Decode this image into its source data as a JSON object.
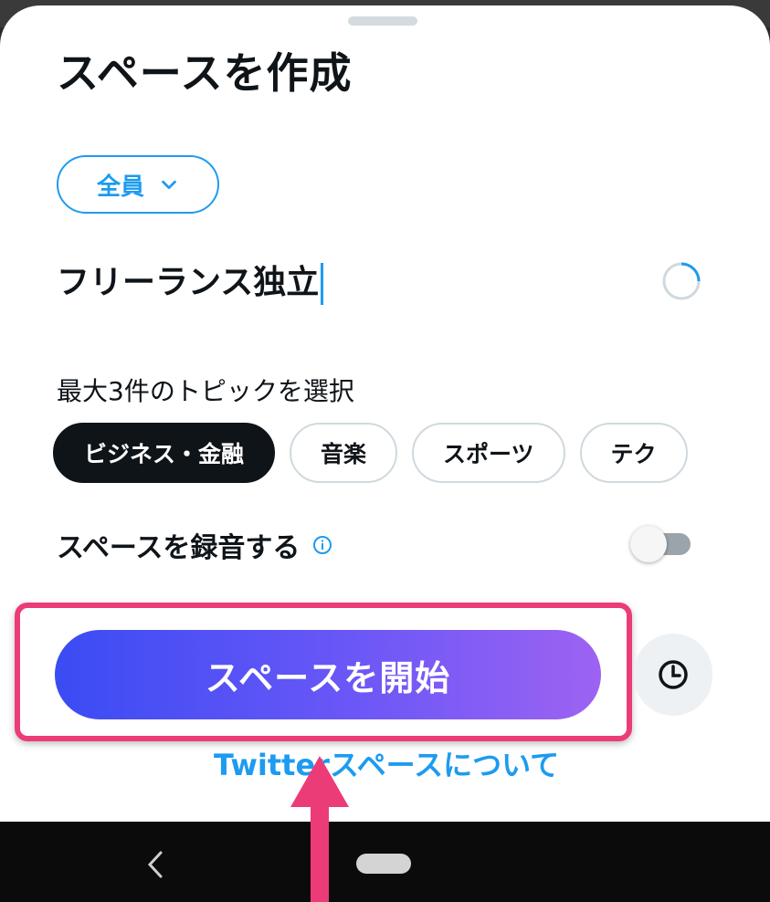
{
  "sheet": {
    "title": "スペースを作成",
    "audience_label": "全員",
    "space_title": "フリーランス独立",
    "topics_label": "最大3件のトピックを選択",
    "topics": [
      {
        "label": "ビジネス・金融",
        "selected": true
      },
      {
        "label": "音楽",
        "selected": false
      },
      {
        "label": "スポーツ",
        "selected": false
      },
      {
        "label": "テク",
        "selected": false
      }
    ],
    "record_label": "スペースを録音する",
    "record_enabled": false,
    "start_button_label": "スペースを開始",
    "about_link": "Twitterスペースについて"
  },
  "icons": {
    "audience_dropdown": "chevron-down-icon",
    "title_counter": "progress-ring-icon",
    "record_info": "info-icon",
    "schedule": "clock-icon",
    "nav_back": "back-icon",
    "nav_home": "home-pill-icon",
    "annotation": "pointer-arrow-icon"
  },
  "colors": {
    "accent": "#1d9bf0",
    "highlight": "#ec3c77",
    "button_gradient_start": "#3a4cf3",
    "button_gradient_end": "#9d63f2",
    "text": "#0f1419"
  }
}
